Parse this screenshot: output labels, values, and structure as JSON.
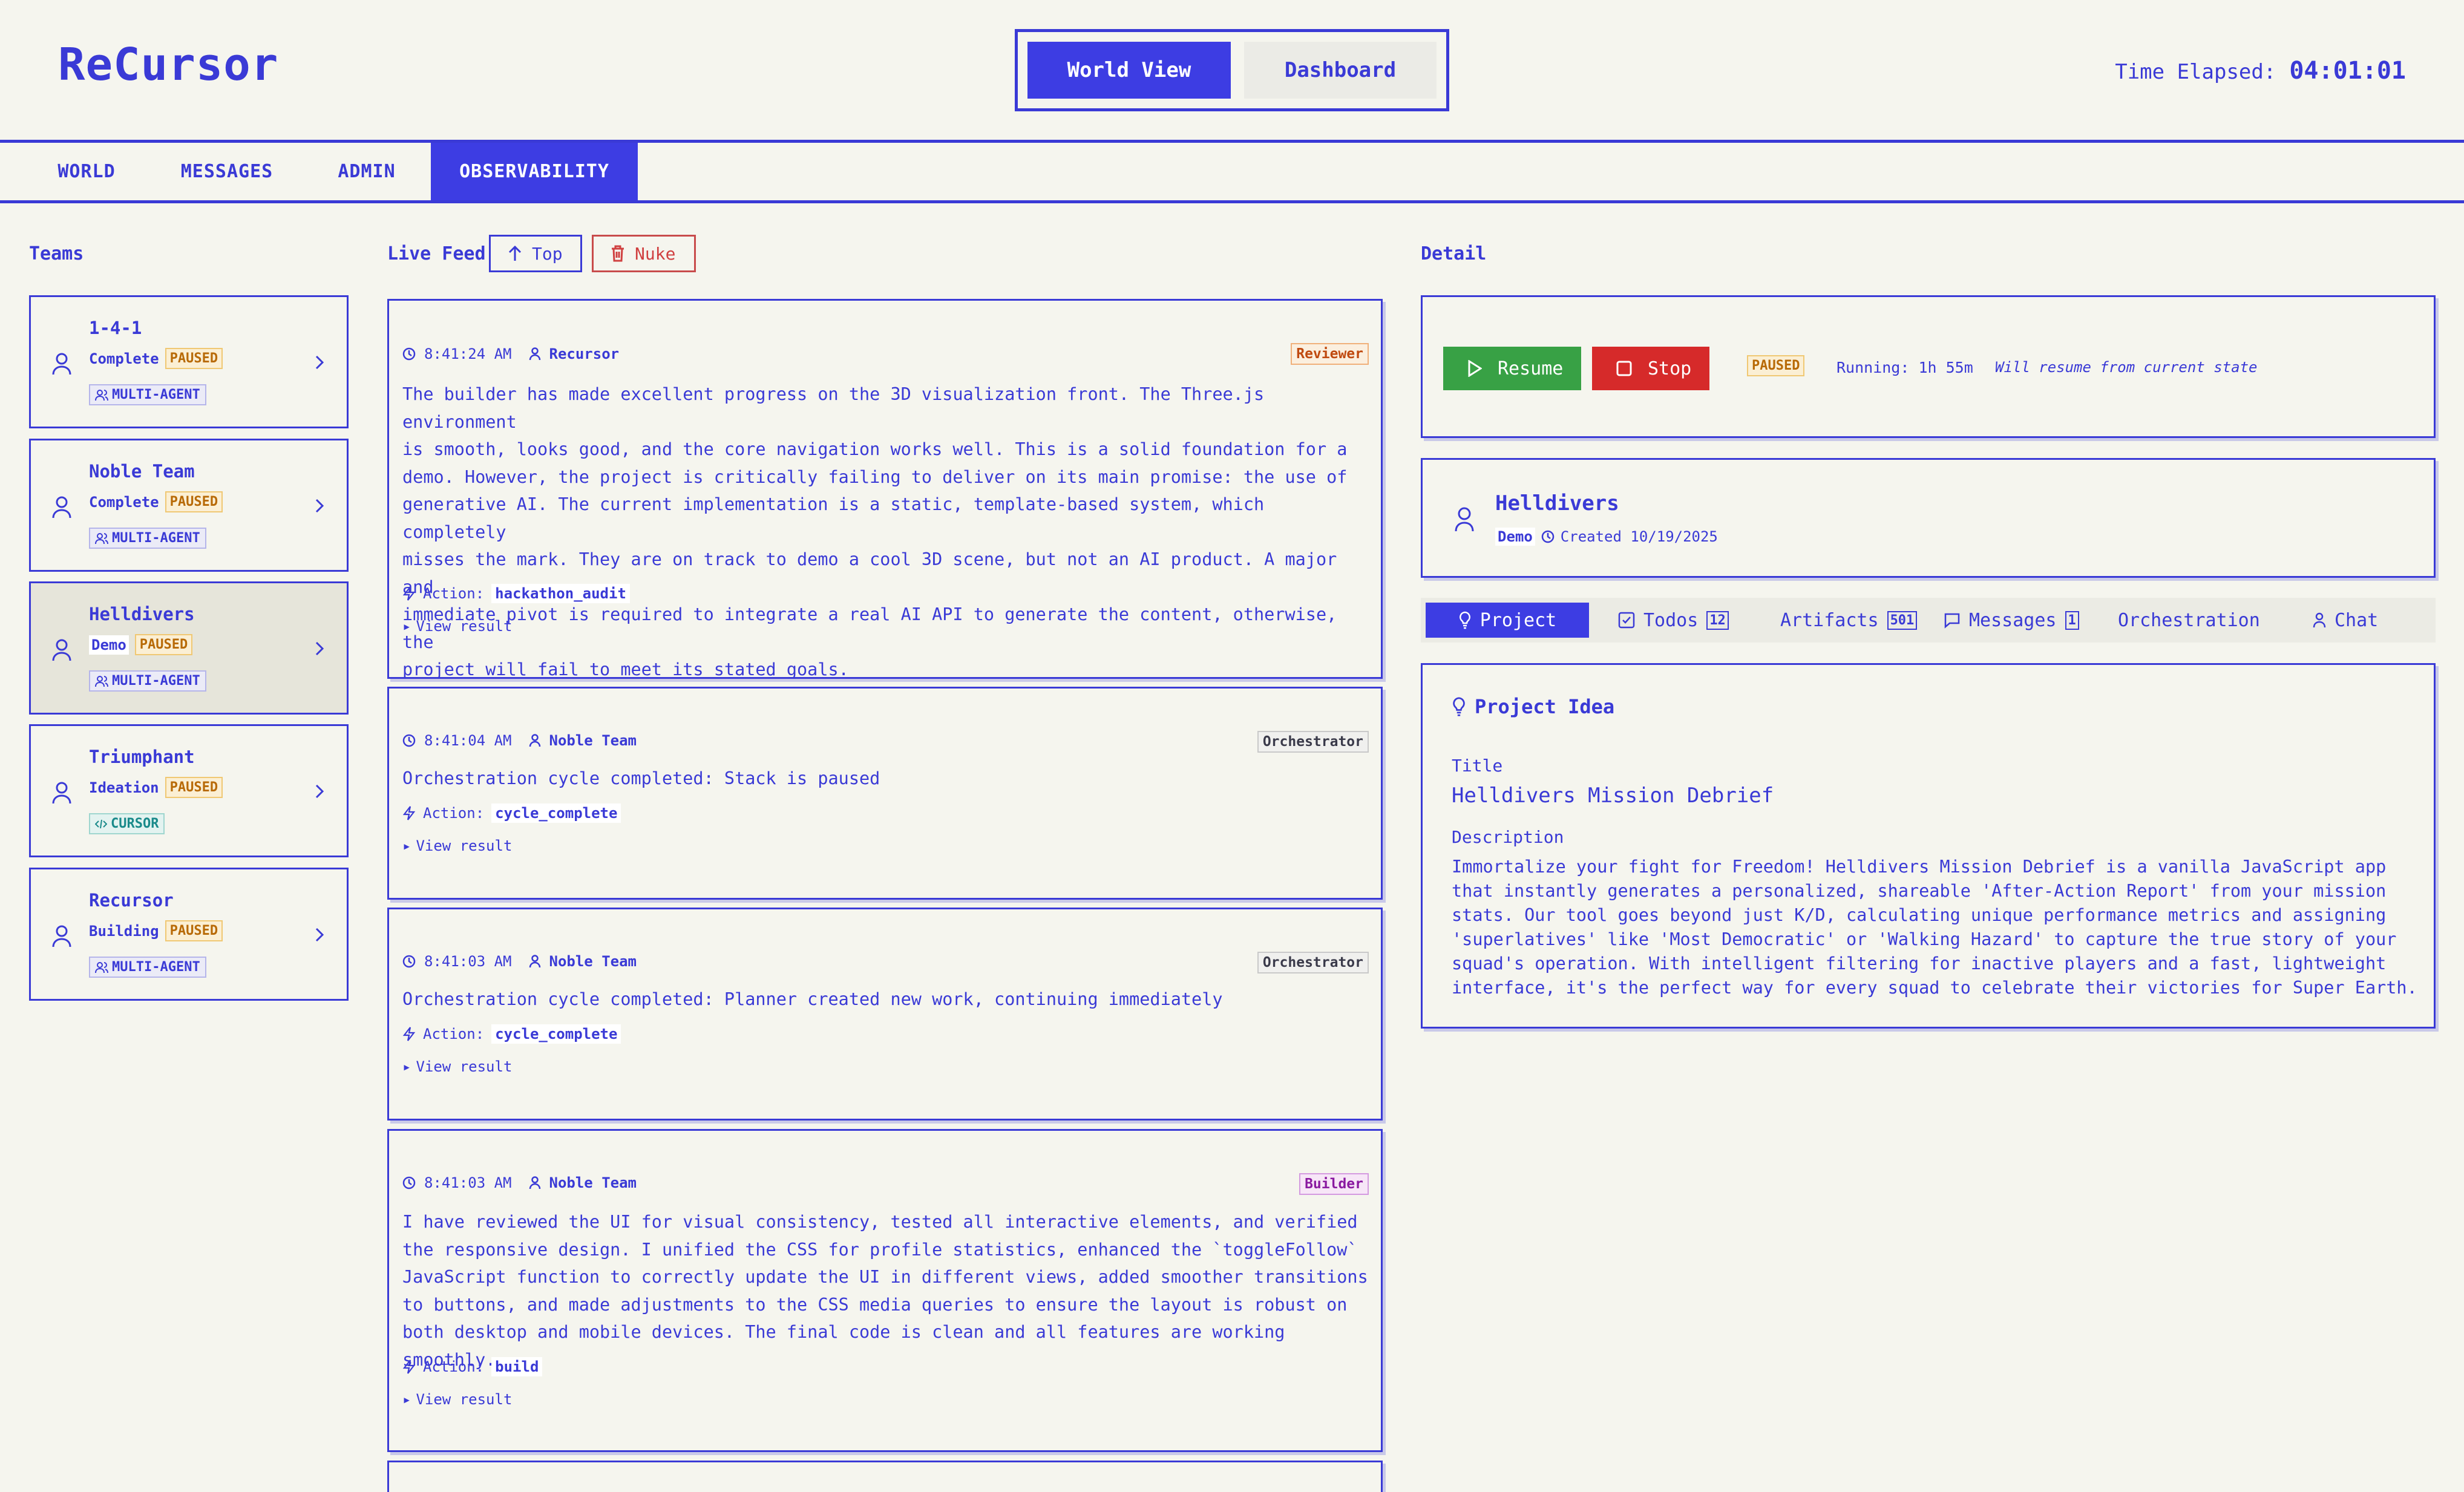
{
  "app": {
    "title": "ReCursor"
  },
  "view_toggle": {
    "world_view": "World View",
    "dashboard": "Dashboard"
  },
  "timer": {
    "label": "Time Elapsed:",
    "value": "04:01:01"
  },
  "nav_tabs": [
    "WORLD",
    "MESSAGES",
    "ADMIN",
    "OBSERVABILITY"
  ],
  "teams": {
    "heading": "Teams",
    "items": [
      {
        "name": "1-4-1",
        "stage": "Complete",
        "status": "PAUSED",
        "type": "MULTI-AGENT"
      },
      {
        "name": "Noble Team",
        "stage": "Complete",
        "status": "PAUSED",
        "type": "MULTI-AGENT"
      },
      {
        "name": "Helldivers",
        "stage": "Demo",
        "status": "PAUSED",
        "type": "MULTI-AGENT"
      },
      {
        "name": "Triumphant",
        "stage": "Ideation",
        "status": "PAUSED",
        "type": "CURSOR"
      },
      {
        "name": "Recursor",
        "stage": "Building",
        "status": "PAUSED",
        "type": "MULTI-AGENT"
      }
    ]
  },
  "feed": {
    "heading": "Live Feed",
    "top_label": "Top",
    "nuke_label": "Nuke",
    "action_label": "Action:",
    "view_result_label": "View result",
    "items": [
      {
        "time": "8:41:24 AM",
        "team": "Recursor",
        "role": "Reviewer",
        "text": "The builder has made excellent progress on the 3D visualization front. The Three.js environment\nis smooth, looks good, and the core navigation works well. This is a solid foundation for a\ndemo. However, the project is critically failing to deliver on its main promise: the use of\ngenerative AI. The current implementation is a static, template-based system, which completely\nmisses the mark. They are on track to demo a cool 3D scene, but not an AI product. A major and\nimmediate pivot is required to integrate a real AI API to generate the content, otherwise, the\nproject will fail to meet its stated goals.",
        "action": "hackathon_audit"
      },
      {
        "time": "8:41:04 AM",
        "team": "Noble Team",
        "role": "Orchestrator",
        "text": "Orchestration cycle completed: Stack is paused",
        "action": "cycle_complete"
      },
      {
        "time": "8:41:03 AM",
        "team": "Noble Team",
        "role": "Orchestrator",
        "text": "Orchestration cycle completed: Planner created new work, continuing immediately",
        "action": "cycle_complete"
      },
      {
        "time": "8:41:03 AM",
        "team": "Noble Team",
        "role": "Builder",
        "text": "I have reviewed the UI for visual consistency, tested all interactive elements, and verified\nthe responsive design. I unified the CSS for profile statistics, enhanced the `toggleFollow`\nJavaScript function to correctly update the UI in different views, added smoother transitions\nto buttons, and made adjustments to the CSS media queries to ensure the layout is robust on\nboth desktop and mobile devices. The final code is clean and all features are working smoothly.",
        "action": "build"
      }
    ]
  },
  "detail": {
    "heading": "Detail",
    "controls": {
      "resume": "Resume",
      "stop": "Stop",
      "status": "PAUSED",
      "running": "Running: 1h 55m",
      "note": "Will resume from current state"
    },
    "team": {
      "name": "Helldivers",
      "stage": "Demo",
      "created": "Created 10/19/2025"
    },
    "tabs": [
      {
        "label": "Project",
        "count": ""
      },
      {
        "label": "Todos",
        "count": "12"
      },
      {
        "label": "Artifacts",
        "count": "501"
      },
      {
        "label": "Messages",
        "count": "1"
      },
      {
        "label": "Orchestration",
        "count": ""
      },
      {
        "label": "Chat",
        "count": ""
      }
    ],
    "project": {
      "heading": "Project Idea",
      "title_label": "Title",
      "title": "Helldivers Mission Debrief",
      "description_label": "Description",
      "description": "Immortalize your fight for Freedom! Helldivers Mission Debrief is a vanilla JavaScript app\nthat instantly generates a personalized, shareable 'After-Action Report' from your mission\nstats. Our tool goes beyond just K/D, calculating unique performance metrics and assigning\n'superlatives' like 'Most Democratic' or 'Walking Hazard' to capture the true story of your\nsquad's operation. With intelligent filtering for inactive players and a fast, lightweight\ninterface, it's the perfect way for every squad to celebrate their victories for Super Earth."
    }
  },
  "colors": {
    "accent": "#3d3de3",
    "background": "#f5f5ee",
    "paused": "#b86a06",
    "resume": "#38a145",
    "stop": "#d62a2a"
  }
}
